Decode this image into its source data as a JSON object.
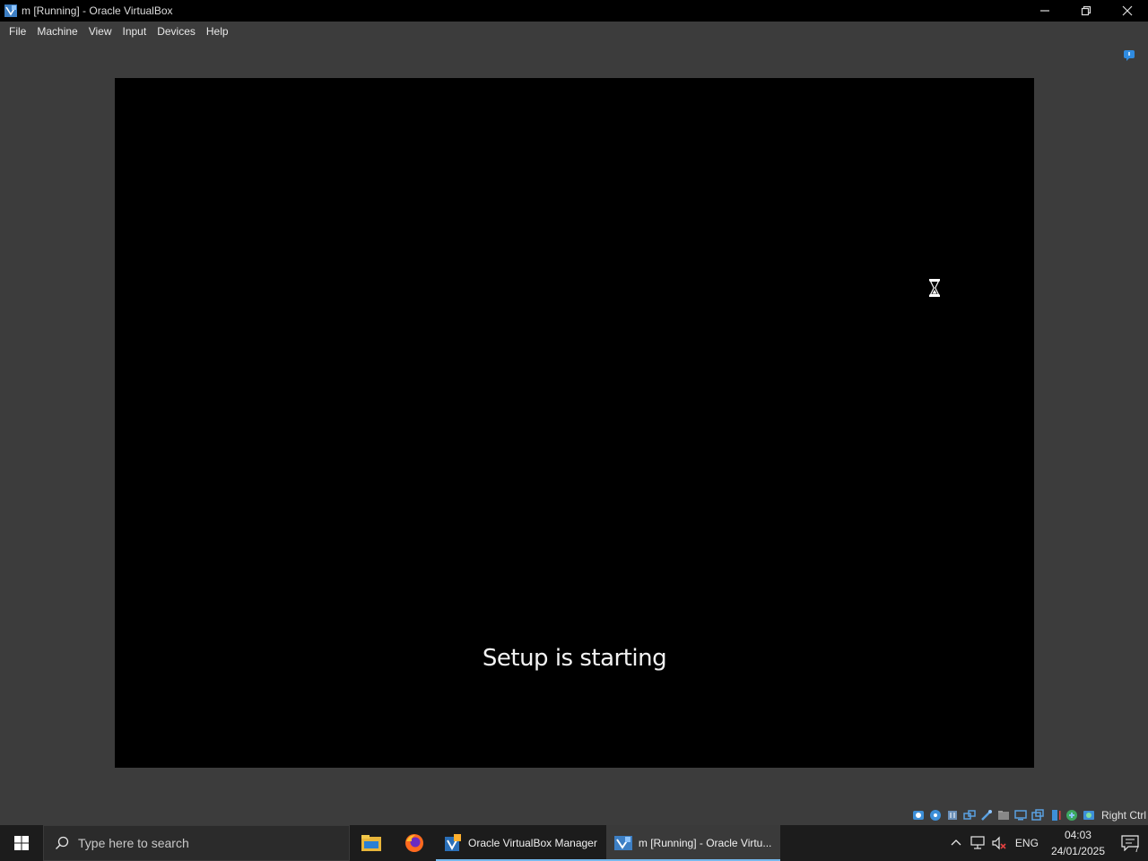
{
  "window": {
    "title": "m [Running] - Oracle VirtualBox",
    "controls": [
      "minimize-icon",
      "restore-icon",
      "close-icon"
    ]
  },
  "menu": {
    "items": [
      "File",
      "Machine",
      "View",
      "Input",
      "Devices",
      "Help"
    ]
  },
  "vm": {
    "message": "Setup is starting",
    "cursor": "hourglass-icon"
  },
  "status_bar": {
    "icons": [
      "hard-disk-icon",
      "optical-drive-icon",
      "audio-icon",
      "network-icon",
      "usb-icon",
      "shared-folders-icon",
      "display-icon",
      "recording-icon",
      "cpu-icon",
      "mouse-integration-icon",
      "keyboard-icon"
    ],
    "host_key": "Right Ctrl"
  },
  "taskbar": {
    "search_placeholder": "Type here to search",
    "apps": [
      {
        "label": "Oracle VirtualBox Manager",
        "icon": "virtualbox-manager-icon"
      },
      {
        "label": "m [Running] - Oracle Virtu...",
        "icon": "virtualbox-vm-icon"
      }
    ],
    "pinned": [
      "file-explorer-icon",
      "firefox-icon"
    ],
    "tray": {
      "language": "ENG",
      "time": "04:03",
      "date": "24/01/2025",
      "notification_count": "7"
    },
    "colors": {
      "accent": "#76b9ed"
    }
  }
}
